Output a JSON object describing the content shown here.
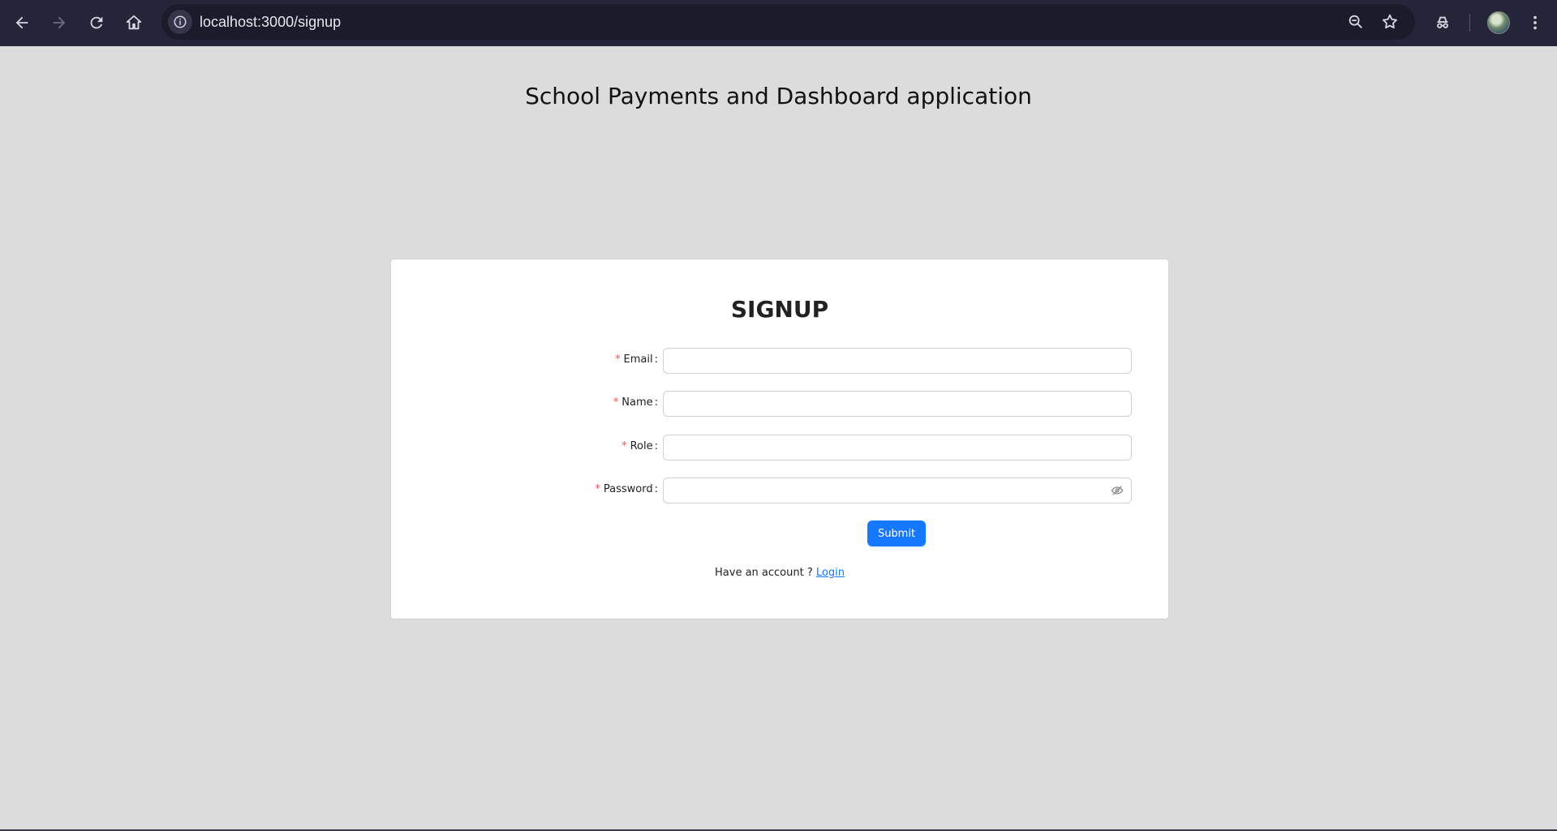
{
  "browser": {
    "url": "localhost:3000/signup",
    "icons": [
      "back-icon",
      "forward-icon",
      "reload-icon",
      "home-icon",
      "site-info-icon",
      "zoom-icon",
      "bookmark-star-icon",
      "incognito-icon",
      "profile-avatar",
      "menu-icon"
    ]
  },
  "page": {
    "title": "School Payments and Dashboard application"
  },
  "signup": {
    "heading": "SIGNUP",
    "fields": [
      {
        "label": "Email",
        "value": "",
        "required": true
      },
      {
        "label": "Name",
        "value": "",
        "required": true
      },
      {
        "label": "Role",
        "value": "",
        "required": true
      },
      {
        "label": "Password",
        "value": "",
        "required": true
      }
    ],
    "required_mark": "*",
    "colon": ":",
    "submit_label": "Submit",
    "have_account_text": "Have an account ?",
    "login_label": "Login"
  },
  "colors": {
    "primary": "#1677ff",
    "required": "#ff4d4f",
    "page_bg": "#dcdcdc",
    "browser_bar": "#25253a"
  }
}
